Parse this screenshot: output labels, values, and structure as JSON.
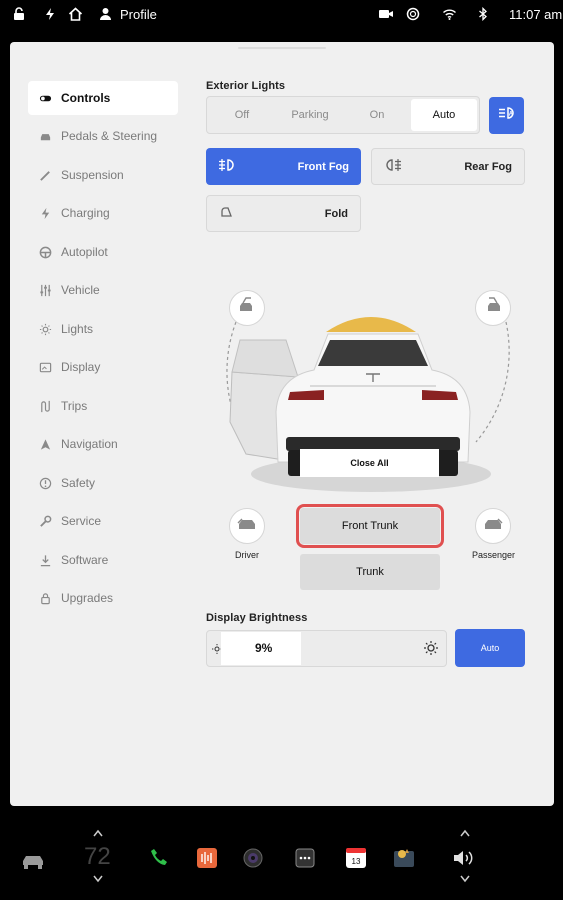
{
  "status_bar": {
    "profile_label": "Profile",
    "time": "11:07 am",
    "icons": [
      "lock-icon",
      "bolt-icon",
      "home-icon",
      "person-icon",
      "camera-icon",
      "circle-icon",
      "wifi-icon",
      "bluetooth-icon"
    ]
  },
  "sidebar": {
    "items": [
      {
        "label": "Controls",
        "icon": "toggle-icon",
        "active": true
      },
      {
        "label": "Pedals & Steering",
        "icon": "car-icon",
        "active": false
      },
      {
        "label": "Suspension",
        "icon": "wrench-line-icon",
        "active": false
      },
      {
        "label": "Charging",
        "icon": "bolt-icon",
        "active": false
      },
      {
        "label": "Autopilot",
        "icon": "steering-wheel-icon",
        "active": false
      },
      {
        "label": "Vehicle",
        "icon": "sliders-icon",
        "active": false
      },
      {
        "label": "Lights",
        "icon": "sun-icon",
        "active": false
      },
      {
        "label": "Display",
        "icon": "display-icon",
        "active": false
      },
      {
        "label": "Trips",
        "icon": "route-icon",
        "active": false
      },
      {
        "label": "Navigation",
        "icon": "navigation-icon",
        "active": false
      },
      {
        "label": "Safety",
        "icon": "alert-circle-icon",
        "active": false
      },
      {
        "label": "Service",
        "icon": "wrench-icon",
        "active": false
      },
      {
        "label": "Software",
        "icon": "download-icon",
        "active": false
      },
      {
        "label": "Upgrades",
        "icon": "lock-icon",
        "active": false
      }
    ]
  },
  "exterior_lights": {
    "title": "Exterior Lights",
    "options": [
      "Off",
      "Parking",
      "On",
      "Auto"
    ],
    "selected": "Auto",
    "front_fog": "Front Fog",
    "rear_fog": "Rear Fog",
    "fold": "Fold"
  },
  "car": {
    "close_all": "Close All",
    "front_trunk": "Front Trunk",
    "trunk": "Trunk",
    "driver": "Driver",
    "passenger": "Passenger"
  },
  "brightness": {
    "title": "Display Brightness",
    "value": "9%",
    "level": 0.09,
    "auto": "Auto"
  },
  "dock": {
    "temperature": "72",
    "calendar_day": "13",
    "icons": [
      "car-icon",
      "phone-icon",
      "audio-icon",
      "camera-app-icon",
      "more-icon",
      "calendar-icon",
      "toybox-icon",
      "volume-icon"
    ]
  },
  "colors": {
    "accent": "#3e6ae1",
    "highlight": "#e05050",
    "panel": "#f0f0f0"
  }
}
